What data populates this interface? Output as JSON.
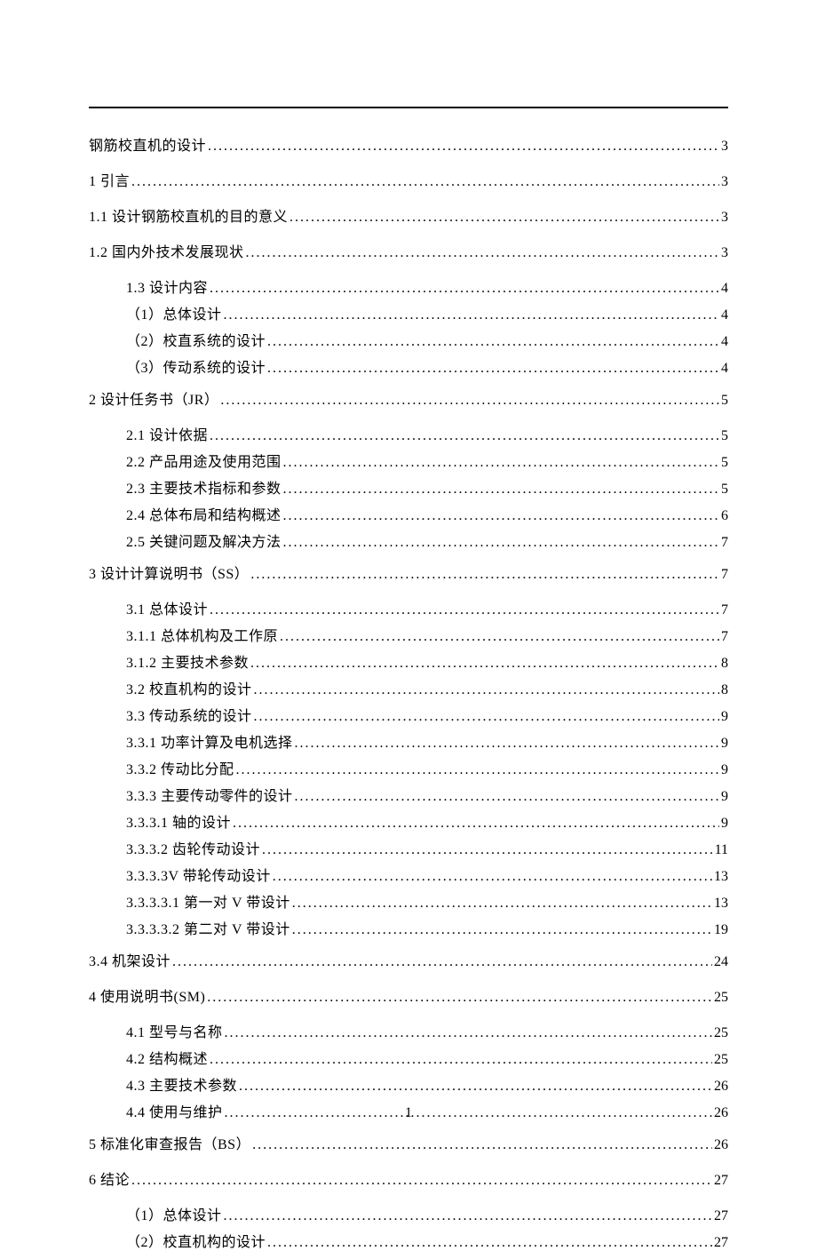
{
  "page_number": "1",
  "toc": [
    {
      "title": "钢筋校直机的设计",
      "page": "3",
      "level": 0
    },
    {
      "title": "1 引言",
      "page": "3",
      "level": 0
    },
    {
      "title": "1.1 设计钢筋校直机的目的意义",
      "page": "3",
      "level": 0
    },
    {
      "title": "1.2 国内外技术发展现状",
      "page": "3",
      "level": 0
    },
    {
      "title": "1.3 设计内容",
      "page": "4",
      "level": 1,
      "gap": true
    },
    {
      "title": "（1）总体设计",
      "page": "4",
      "level": 1
    },
    {
      "title": "（2）校直系统的设计",
      "page": "4",
      "level": 1
    },
    {
      "title": "（3）传动系统的设计",
      "page": "4",
      "level": 1
    },
    {
      "title": "2 设计任务书（JR）",
      "page": "5",
      "level": 0,
      "gap": true
    },
    {
      "title": "2.1 设计依据",
      "page": "5",
      "level": 1,
      "gap": true
    },
    {
      "title": "2.2 产品用途及使用范围",
      "page": "5",
      "level": 1
    },
    {
      "title": "2.3 主要技术指标和参数",
      "page": "5",
      "level": 1
    },
    {
      "title": "2.4 总体布局和结构概述",
      "page": "6",
      "level": 1
    },
    {
      "title": "2.5 关键问题及解决方法",
      "page": "7",
      "level": 1
    },
    {
      "title": "3 设计计算说明书（SS）",
      "page": "7",
      "level": 0,
      "gap": true
    },
    {
      "title": "3.1 总体设计",
      "page": "7",
      "level": 1,
      "gap": true
    },
    {
      "title": "3.1.1 总体机构及工作原",
      "page": "7",
      "level": 1
    },
    {
      "title": "3.1.2 主要技术参数",
      "page": "8",
      "level": 1
    },
    {
      "title": "3.2 校直机构的设计",
      "page": "8",
      "level": 1
    },
    {
      "title": "3.3 传动系统的设计",
      "page": "9",
      "level": 1
    },
    {
      "title": "3.3.1 功率计算及电机选择",
      "page": "9",
      "level": 1
    },
    {
      "title": "3.3.2 传动比分配",
      "page": "9",
      "level": 1
    },
    {
      "title": "3.3.3 主要传动零件的设计",
      "page": "9",
      "level": 1
    },
    {
      "title": "3.3.3.1 轴的设计",
      "page": "9",
      "level": 1
    },
    {
      "title": "3.3.3.2 齿轮传动设计",
      "page": "11",
      "level": 1
    },
    {
      "title": "3.3.3.3V 带轮传动设计",
      "page": "13",
      "level": 1
    },
    {
      "title": "3.3.3.3.1 第一对 V 带设计",
      "page": "13",
      "level": 1
    },
    {
      "title": "3.3.3.3.2 第二对 V 带设计",
      "page": "19",
      "level": 1
    },
    {
      "title": "3.4 机架设计",
      "page": "24",
      "level": 0,
      "gap": true
    },
    {
      "title": "4 使用说明书(SM)",
      "page": "25",
      "level": 0,
      "gap": true
    },
    {
      "title": "4.1 型号与名称",
      "page": "25",
      "level": 1,
      "gap": true
    },
    {
      "title": "4.2 结构概述",
      "page": "25",
      "level": 1
    },
    {
      "title": "4.3 主要技术参数",
      "page": "26",
      "level": 1
    },
    {
      "title": "4.4 使用与维护",
      "page": "26",
      "level": 1
    },
    {
      "title": "5 标准化审查报告（BS）",
      "page": "26",
      "level": 0,
      "gap": true
    },
    {
      "title": "6 结论",
      "page": "27",
      "level": 0,
      "gap": true
    },
    {
      "title": "（1）总体设计",
      "page": "27",
      "level": 1,
      "gap": true
    },
    {
      "title": "（2）校直机构的设计",
      "page": "27",
      "level": 1
    }
  ]
}
